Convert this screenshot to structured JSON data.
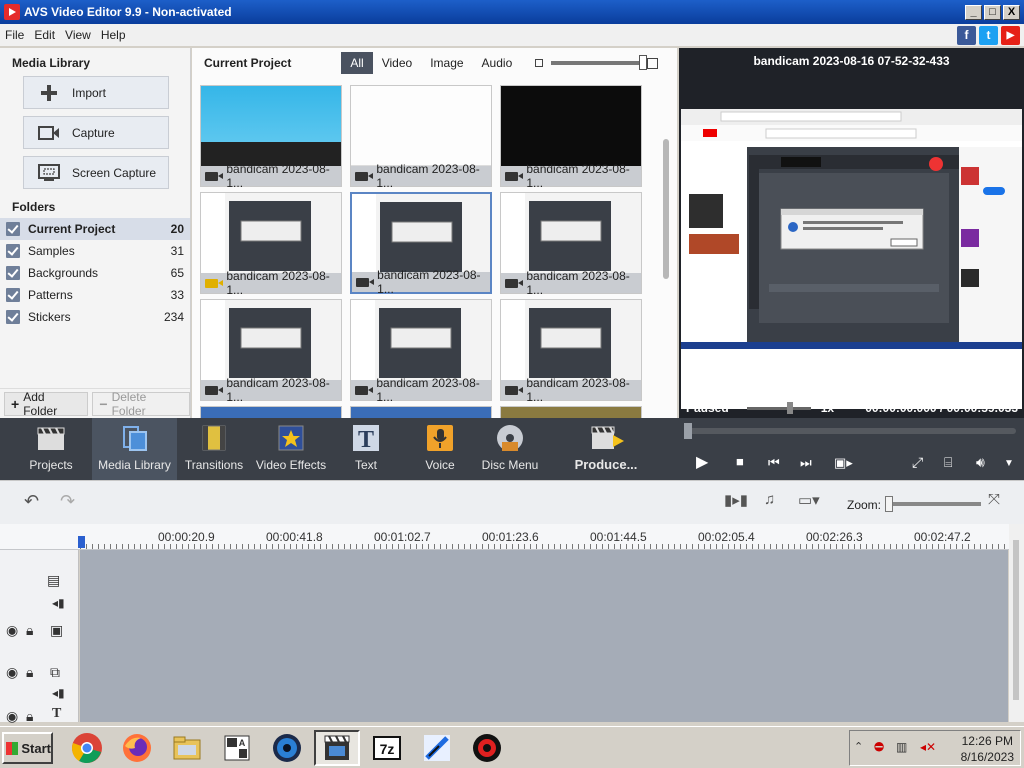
{
  "window": {
    "title": "AVS Video Editor 9.9 - Non-activated",
    "min": "_",
    "max": "□",
    "close": "X"
  },
  "menu": [
    "File",
    "Edit",
    "View",
    "Help"
  ],
  "social": [
    {
      "name": "facebook-icon",
      "glyph": "f",
      "color": "#3b5998"
    },
    {
      "name": "twitter-icon",
      "glyph": "t",
      "color": "#1da1f2"
    },
    {
      "name": "youtube-icon",
      "glyph": "▶",
      "color": "#e62117"
    }
  ],
  "media_library": {
    "title": "Media Library",
    "buttons": [
      {
        "id": "import",
        "label": "Import",
        "icon": "plus-icon"
      },
      {
        "id": "capture",
        "label": "Capture",
        "icon": "camera-icon"
      },
      {
        "id": "screen-capture",
        "label": "Screen Capture",
        "icon": "screen-capture-icon"
      }
    ],
    "folders_title": "Folders",
    "folders": [
      {
        "name": "Current Project",
        "count": "20",
        "selected": true
      },
      {
        "name": "Samples",
        "count": "31"
      },
      {
        "name": "Backgrounds",
        "count": "65"
      },
      {
        "name": "Patterns",
        "count": "33"
      },
      {
        "name": "Stickers",
        "count": "234"
      }
    ],
    "add_folder": "Add Folder",
    "delete_folder": "Delete Folder"
  },
  "project": {
    "title": "Current Project",
    "filters": [
      "All",
      "Video",
      "Image",
      "Audio"
    ],
    "active_filter": "All",
    "thumb_label": "bandicam 2023-08-1...",
    "thumbs": 12
  },
  "preview": {
    "title": "bandicam 2023-08-16 07-52-32-433",
    "state": "Paused",
    "speed": "1x",
    "time_current": "00:00:00.000",
    "time_sep": "/",
    "time_total": "00:00:59.033"
  },
  "toolbar": {
    "tools": [
      {
        "id": "projects",
        "label": "Projects"
      },
      {
        "id": "media-library",
        "label": "Media Library",
        "active": true
      },
      {
        "id": "transitions",
        "label": "Transitions"
      },
      {
        "id": "video-effects",
        "label": "Video Effects"
      },
      {
        "id": "text",
        "label": "Text"
      },
      {
        "id": "voice",
        "label": "Voice"
      },
      {
        "id": "disc-menu",
        "label": "Disc Menu"
      },
      {
        "id": "produce",
        "label": "Produce..."
      }
    ]
  },
  "timeline": {
    "zoom_label": "Zoom:",
    "ruler": [
      "00:00:20.9",
      "00:00:41.8",
      "00:01:02.7",
      "00:01:23.6",
      "00:01:44.5",
      "00:02:05.4",
      "00:02:26.3",
      "00:02:47.2"
    ]
  },
  "taskbar": {
    "start": "Start",
    "clock_time": "12:26 PM",
    "clock_date": "8/16/2023"
  }
}
